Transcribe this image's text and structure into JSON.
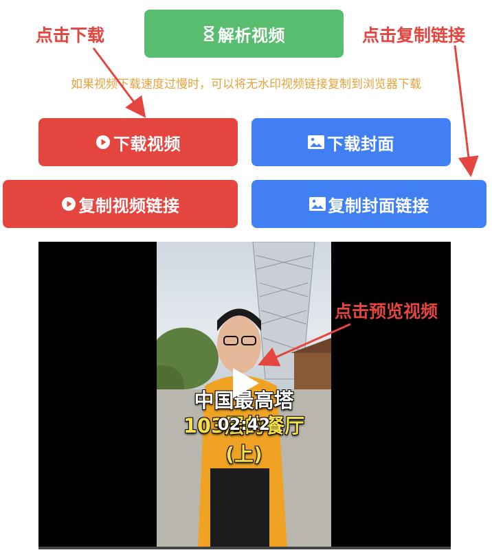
{
  "annotations": {
    "click_download": "点击下载",
    "click_copy_link": "点击复制链接",
    "click_preview": "点击预览视频"
  },
  "parse_button": {
    "label": "解析视频",
    "icon": "hourglass-icon"
  },
  "tip": "如果视频下载速度过慢时，可以将无水印视频链接复制到浏览器下载",
  "buttons": {
    "download_video": "下载视频",
    "download_cover": "下载封面",
    "copy_video_link": "复制视频链接",
    "copy_cover_link": "复制封面链接"
  },
  "video": {
    "duration": "02:42",
    "caption_line1": "中国最高塔",
    "caption_line2": "103层的餐厅",
    "caption_line3": "(上)"
  },
  "colors": {
    "red": "#e5453f",
    "blue": "#4080f4",
    "green": "#58bd6f",
    "tip": "#e6a23c"
  }
}
